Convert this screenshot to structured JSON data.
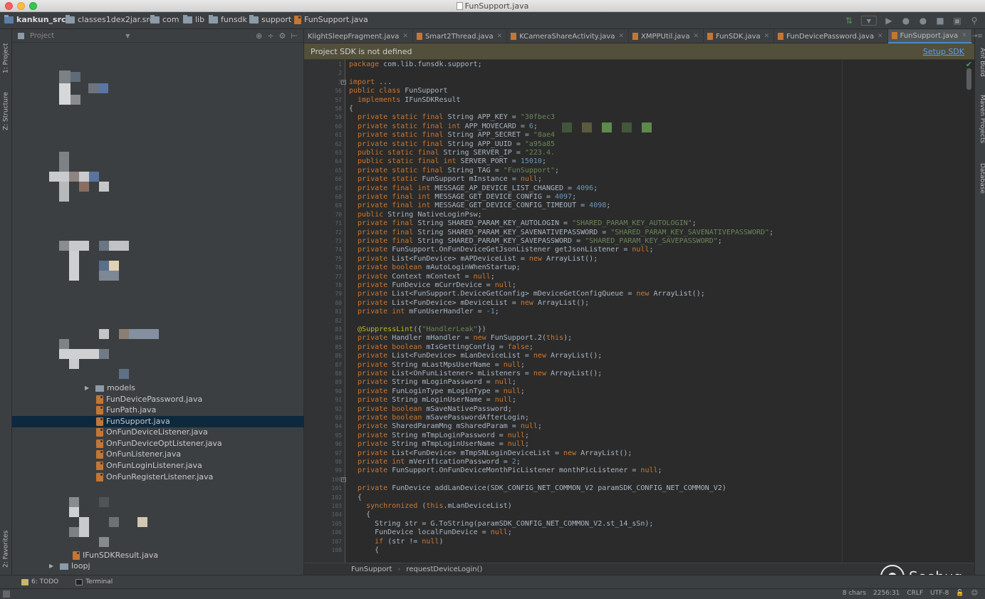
{
  "window": {
    "title": "FunSupport.java"
  },
  "breadcrumb": [
    "kankun_src",
    "classes1dex2jar.src",
    "com",
    "lib",
    "funsdk",
    "support",
    "FunSupport.java"
  ],
  "left_strip": {
    "project": "1: Project",
    "structure": "Z: Structure",
    "favorites": "2: Favorites"
  },
  "right_strip": {
    "ant": "Ant Build",
    "maven": "Maven Projects",
    "database": "Database"
  },
  "project_panel": {
    "selector": "Project",
    "items": [
      {
        "label": "models",
        "kind": "folder"
      },
      {
        "label": "FunDevicePassword.java",
        "kind": "java"
      },
      {
        "label": "FunPath.java",
        "kind": "java"
      },
      {
        "label": "FunSupport.java",
        "kind": "java",
        "selected": true
      },
      {
        "label": "OnFunDeviceListener.java",
        "kind": "java"
      },
      {
        "label": "OnFunDeviceOptListener.java",
        "kind": "java"
      },
      {
        "label": "OnFunListener.java",
        "kind": "java"
      },
      {
        "label": "OnFunLoginListener.java",
        "kind": "java"
      },
      {
        "label": "OnFunRegisterListener.java",
        "kind": "java"
      },
      {
        "label": "IFunSDKResult.java",
        "kind": "java"
      },
      {
        "label": "loopj",
        "kind": "folder"
      }
    ]
  },
  "tabs": [
    {
      "label": "KlightSleepFragment.java"
    },
    {
      "label": "Smart2Thread.java"
    },
    {
      "label": "KCameraShareActivity.java"
    },
    {
      "label": "XMPPUtil.java"
    },
    {
      "label": "FunSDK.java"
    },
    {
      "label": "FunDevicePassword.java"
    },
    {
      "label": "FunSupport.java",
      "active": true
    }
  ],
  "banner": {
    "message": "Project SDK is not defined",
    "action": "Setup SDK"
  },
  "editor": {
    "line_numbers": [
      "1",
      "2",
      "3",
      "56",
      "57",
      "58",
      "59",
      "60",
      "61",
      "62",
      "63",
      "64",
      "65",
      "66",
      "67",
      "68",
      "69",
      "70",
      "71",
      "72",
      "73",
      "74",
      "75",
      "76",
      "77",
      "78",
      "79",
      "80",
      "81",
      "82",
      "83",
      "84",
      "85",
      "86",
      "87",
      "88",
      "89",
      "90",
      "91",
      "92",
      "93",
      "94",
      "95",
      "96",
      "97",
      "98",
      "99",
      "100",
      "101",
      "102",
      "103",
      "104",
      "105",
      "106",
      "107",
      "108"
    ],
    "lines": [
      [
        [
          "kw",
          "package "
        ],
        [
          "t",
          "com.lib.funsdk.support;"
        ]
      ],
      [],
      [
        [
          "kw",
          "import "
        ],
        [
          "t",
          "..."
        ]
      ],
      [
        [
          "kw",
          "public class "
        ],
        [
          "t",
          "FunSupport"
        ]
      ],
      [
        [
          "kw",
          "  implements "
        ],
        [
          "t",
          "IFunSDKResult"
        ]
      ],
      [
        [
          "t",
          "{"
        ]
      ],
      [
        [
          "kw",
          "  private static final "
        ],
        [
          "t",
          "String APP_KEY = "
        ],
        [
          "str",
          "\"30fbec3"
        ]
      ],
      [
        [
          "kw",
          "  private static final int "
        ],
        [
          "t",
          "APP_MOVECARD = "
        ],
        [
          "num",
          "6"
        ],
        [
          "t",
          ";"
        ]
      ],
      [
        [
          "kw",
          "  private static final "
        ],
        [
          "t",
          "String APP_SECRET = "
        ],
        [
          "str",
          "\"8ae4"
        ]
      ],
      [
        [
          "kw",
          "  private static final "
        ],
        [
          "t",
          "String APP_UUID = "
        ],
        [
          "str",
          "\"a95a85"
        ]
      ],
      [
        [
          "kw",
          "  public static final "
        ],
        [
          "t",
          "String SERVER_IP = "
        ],
        [
          "str",
          "\"223.4."
        ]
      ],
      [
        [
          "kw",
          "  public static final int "
        ],
        [
          "t",
          "SERVER_PORT = "
        ],
        [
          "num",
          "15010"
        ],
        [
          "t",
          ";"
        ]
      ],
      [
        [
          "kw",
          "  private static final "
        ],
        [
          "t",
          "String TAG = "
        ],
        [
          "str",
          "\"FunSupport\""
        ],
        [
          "t",
          ";"
        ]
      ],
      [
        [
          "kw",
          "  private static "
        ],
        [
          "t",
          "FunSupport mInstance = "
        ],
        [
          "kw",
          "null"
        ],
        [
          "t",
          ";"
        ]
      ],
      [
        [
          "kw",
          "  private final int "
        ],
        [
          "t",
          "MESSAGE_AP_DEVICE_LIST_CHANGED = "
        ],
        [
          "num",
          "4096"
        ],
        [
          "t",
          ";"
        ]
      ],
      [
        [
          "kw",
          "  private final int "
        ],
        [
          "t",
          "MESSAGE_GET_DEVICE_CONFIG = "
        ],
        [
          "num",
          "4097"
        ],
        [
          "t",
          ";"
        ]
      ],
      [
        [
          "kw",
          "  private final int "
        ],
        [
          "t",
          "MESSAGE_GET_DEVICE_CONFIG_TIMEOUT = "
        ],
        [
          "num",
          "4098"
        ],
        [
          "t",
          ";"
        ]
      ],
      [
        [
          "kw",
          "  public "
        ],
        [
          "t",
          "String NativeLoginPsw;"
        ]
      ],
      [
        [
          "kw",
          "  private final "
        ],
        [
          "t",
          "String SHARED_PARAM_KEY_AUTOLOGIN = "
        ],
        [
          "str",
          "\"SHARED_PARAM_KEY_AUTOLOGIN\""
        ],
        [
          "t",
          ";"
        ]
      ],
      [
        [
          "kw",
          "  private final "
        ],
        [
          "t",
          "String SHARED_PARAM_KEY_SAVENATIVEPASSWORD = "
        ],
        [
          "str",
          "\"SHARED_PARAM_KEY_SAVENATIVEPASSWORD\""
        ],
        [
          "t",
          ";"
        ]
      ],
      [
        [
          "kw",
          "  private final "
        ],
        [
          "t",
          "String SHARED_PARAM_KEY_SAVEPASSWORD = "
        ],
        [
          "str",
          "\"SHARED_PARAM_KEY_SAVEPASSWORD\""
        ],
        [
          "t",
          ";"
        ]
      ],
      [
        [
          "kw",
          "  private "
        ],
        [
          "t",
          "FunSupport.OnFunDeviceGetJsonListener getJsonListener = "
        ],
        [
          "kw",
          "null"
        ],
        [
          "t",
          ";"
        ]
      ],
      [
        [
          "kw",
          "  private "
        ],
        [
          "t",
          "List<FunDevice> mAPDeviceList = "
        ],
        [
          "kw",
          "new "
        ],
        [
          "t",
          "ArrayList();"
        ]
      ],
      [
        [
          "kw",
          "  private boolean "
        ],
        [
          "t",
          "mAutoLoginWhenStartup;"
        ]
      ],
      [
        [
          "kw",
          "  private "
        ],
        [
          "t",
          "Context mContext = "
        ],
        [
          "kw",
          "null"
        ],
        [
          "t",
          ";"
        ]
      ],
      [
        [
          "kw",
          "  private "
        ],
        [
          "t",
          "FunDevice mCurrDevice = "
        ],
        [
          "kw",
          "null"
        ],
        [
          "t",
          ";"
        ]
      ],
      [
        [
          "kw",
          "  private "
        ],
        [
          "t",
          "List<FunSupport.DeviceGetConfig> mDeviceGetConfigQueue = "
        ],
        [
          "kw",
          "new "
        ],
        [
          "t",
          "ArrayList();"
        ]
      ],
      [
        [
          "kw",
          "  private "
        ],
        [
          "t",
          "List<FunDevice> mDeviceList = "
        ],
        [
          "kw",
          "new "
        ],
        [
          "t",
          "ArrayList();"
        ]
      ],
      [
        [
          "kw",
          "  private int "
        ],
        [
          "t",
          "mFunUserHandler = "
        ],
        [
          "num",
          "-1"
        ],
        [
          "t",
          ";"
        ]
      ],
      [],
      [
        [
          "ann",
          "  @SuppressLint"
        ],
        [
          "t",
          "({"
        ],
        [
          "str",
          "\"HandlerLeak\""
        ],
        [
          "t",
          "})"
        ]
      ],
      [
        [
          "kw",
          "  private "
        ],
        [
          "t",
          "Handler mHandler = "
        ],
        [
          "kw",
          "new "
        ],
        [
          "t",
          "FunSupport.2("
        ],
        [
          "kw",
          "this"
        ],
        [
          "t",
          ");"
        ]
      ],
      [
        [
          "kw",
          "  private boolean "
        ],
        [
          "t",
          "mIsGettingConfig = "
        ],
        [
          "kw",
          "false"
        ],
        [
          "t",
          ";"
        ]
      ],
      [
        [
          "kw",
          "  private "
        ],
        [
          "t",
          "List<FunDevice> mLanDeviceList = "
        ],
        [
          "kw",
          "new "
        ],
        [
          "t",
          "ArrayList();"
        ]
      ],
      [
        [
          "kw",
          "  private "
        ],
        [
          "t",
          "String mLastMpsUserName = "
        ],
        [
          "kw",
          "null"
        ],
        [
          "t",
          ";"
        ]
      ],
      [
        [
          "kw",
          "  private "
        ],
        [
          "t",
          "List<OnFunListener> mListeners = "
        ],
        [
          "kw",
          "new "
        ],
        [
          "t",
          "ArrayList();"
        ]
      ],
      [
        [
          "kw",
          "  private "
        ],
        [
          "t",
          "String mLoginPassword = "
        ],
        [
          "kw",
          "null"
        ],
        [
          "t",
          ";"
        ]
      ],
      [
        [
          "kw",
          "  private "
        ],
        [
          "t",
          "FunLoginType mLoginType = "
        ],
        [
          "kw",
          "null"
        ],
        [
          "t",
          ";"
        ]
      ],
      [
        [
          "kw",
          "  private "
        ],
        [
          "t",
          "String mLoginUserName = "
        ],
        [
          "kw",
          "null"
        ],
        [
          "t",
          ";"
        ]
      ],
      [
        [
          "kw",
          "  private boolean "
        ],
        [
          "t",
          "mSaveNativePassword;"
        ]
      ],
      [
        [
          "kw",
          "  private boolean "
        ],
        [
          "t",
          "mSavePasswordAfterLogin;"
        ]
      ],
      [
        [
          "kw",
          "  private "
        ],
        [
          "t",
          "SharedParamMng mSharedParam = "
        ],
        [
          "kw",
          "null"
        ],
        [
          "t",
          ";"
        ]
      ],
      [
        [
          "kw",
          "  private "
        ],
        [
          "t",
          "String mTmpLoginPassword = "
        ],
        [
          "kw",
          "null"
        ],
        [
          "t",
          ";"
        ]
      ],
      [
        [
          "kw",
          "  private "
        ],
        [
          "t",
          "String mTmpLoginUserName = "
        ],
        [
          "kw",
          "null"
        ],
        [
          "t",
          ";"
        ]
      ],
      [
        [
          "kw",
          "  private "
        ],
        [
          "t",
          "List<FunDevice> mTmpSNLoginDeviceList = "
        ],
        [
          "kw",
          "new "
        ],
        [
          "t",
          "ArrayList();"
        ]
      ],
      [
        [
          "kw",
          "  private int "
        ],
        [
          "t",
          "mVerificationPassword = "
        ],
        [
          "num",
          "2"
        ],
        [
          "t",
          ";"
        ]
      ],
      [
        [
          "kw",
          "  private "
        ],
        [
          "t",
          "FunSupport.OnFunDeviceMonthPicListener monthPicListener = "
        ],
        [
          "kw",
          "null"
        ],
        [
          "t",
          ";"
        ]
      ],
      [],
      [
        [
          "kw",
          "  private "
        ],
        [
          "t",
          "FunDevice addLanDevice(SDK_CONFIG_NET_COMMON_V2 paramSDK_CONFIG_NET_COMMON_V2)"
        ]
      ],
      [
        [
          "t",
          "  {"
        ]
      ],
      [
        [
          "kw",
          "    synchronized "
        ],
        [
          "t",
          "("
        ],
        [
          "kw",
          "this"
        ],
        [
          "t",
          ".mLanDeviceList)"
        ]
      ],
      [
        [
          "t",
          "    {"
        ]
      ],
      [
        [
          "t",
          "      String str = G.ToString(paramSDK_CONFIG_NET_COMMON_V2.st_14_sSn);"
        ]
      ],
      [
        [
          "t",
          "      FunDevice localFunDevice = "
        ],
        [
          "kw",
          "null"
        ],
        [
          "t",
          ";"
        ]
      ],
      [
        [
          "kw",
          "      if "
        ],
        [
          "t",
          "(str != "
        ],
        [
          "kw",
          "null"
        ],
        [
          "t",
          ")"
        ]
      ],
      [
        [
          "t",
          "      {"
        ]
      ]
    ]
  },
  "editor_crumbs": [
    "FunSupport",
    "requestDeviceLogin()"
  ],
  "bottom_tabs": {
    "todo": "6: TODO",
    "terminal": "Terminal"
  },
  "status": {
    "chars": "8 chars",
    "position": "2256:31",
    "line_sep": "CRLF",
    "encoding": "UTF-8"
  },
  "watermark": "Seebug"
}
